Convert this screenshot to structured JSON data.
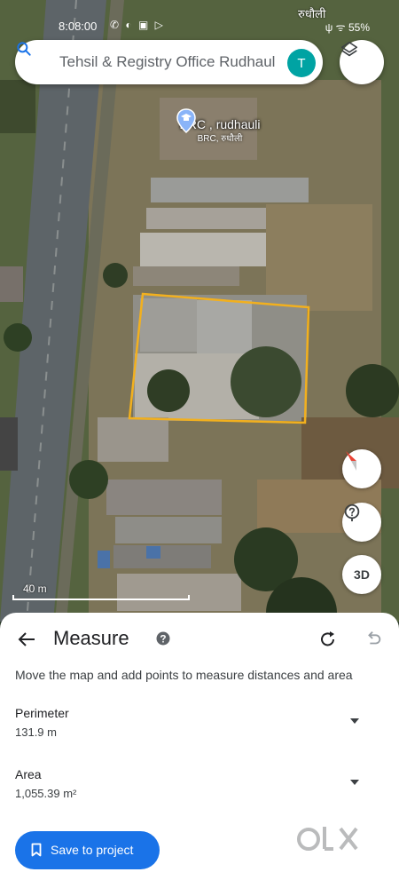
{
  "status_bar": {
    "time": "8:08:00",
    "notification_icons": "✆ ◐ ▣ ▷",
    "right": "ψ ᯤ 55%",
    "map_label": "रुधौली"
  },
  "search": {
    "text": "Tehsil & Registry Office Rudhaul",
    "avatar_letter": "T"
  },
  "poi": {
    "name": "BRC , rudhauli",
    "sub": "BRC, रुधौली"
  },
  "map_controls": {
    "threed_label": "3D",
    "scale_label": "40 m"
  },
  "measure": {
    "title": "Measure",
    "instructions": "Move the map and add points to measure distances and area",
    "perimeter_label": "Perimeter",
    "perimeter_value": "131.9 m",
    "area_label": "Area",
    "area_value": "1,055.39 m²",
    "save_label": "Save to project"
  },
  "colors": {
    "accent": "#1a73e8",
    "measure_outline": "#f2b01e",
    "avatar": "#00a3a3"
  },
  "watermark": "OLX"
}
